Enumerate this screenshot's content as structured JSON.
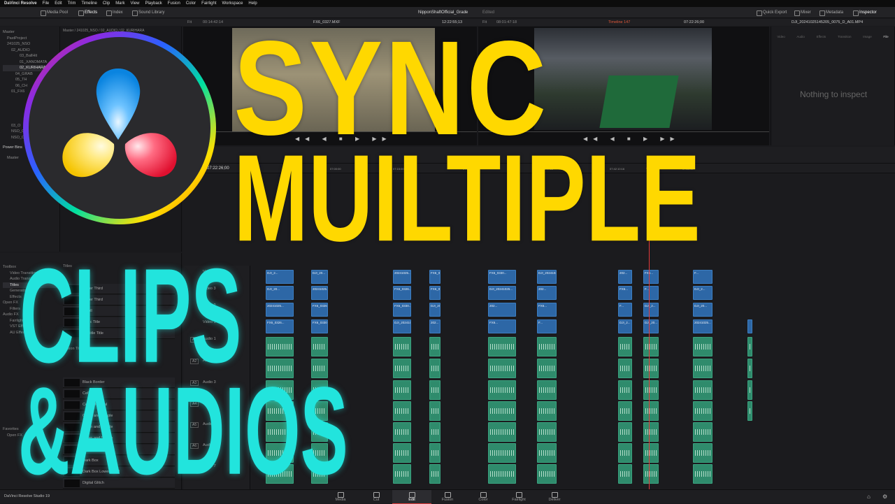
{
  "menu": {
    "items": [
      "DaVinci Resolve",
      "File",
      "Edit",
      "Trim",
      "Timeline",
      "Clip",
      "Mark",
      "View",
      "Playback",
      "Fusion",
      "Color",
      "Fairlight",
      "Workspace",
      "Help"
    ]
  },
  "toolbar": {
    "media_pool": "Media Pool",
    "effects": "Effects",
    "index": "Index",
    "sound_library": "Sound Library",
    "project_title": "NipponShaftOfficial_Grade",
    "edited": "Edited",
    "quick_export": "Quick Export",
    "mixer": "Mixer",
    "metadata": "Metadata",
    "inspector": "Inspector"
  },
  "source_viewer": {
    "fit": "Fit",
    "duration": "00:14:42:14",
    "clip_name": "FX6_0327.MXF",
    "timecode": "12:22:55;13"
  },
  "timeline_viewer": {
    "fit": "Fit",
    "duration": "08:01:47:18",
    "timeline_name": "Timeline 147",
    "timecode": "07:22:26;00"
  },
  "media_pool": {
    "path": "Master / 241025_NSO / 02_AUDIO / 02_KURIHARA",
    "tree": [
      "Master",
      "PastProject",
      "241025_NSO",
      "02_AUDIO",
      "03_BallHit",
      "01_XANOMATA",
      "02_KURIHARA",
      "04_GRAB",
      "05_TH",
      "06_CH",
      "01_FX6",
      "03_O",
      "NSO_C",
      "NSO_OFF"
    ],
    "power_bins": "Power Bins",
    "power_master": "Master"
  },
  "inspector": {
    "clip_name": "DJI_20241025145205_0075_D_A01.MP4",
    "tabs": [
      "Video",
      "Audio",
      "Effects",
      "Transition",
      "Image",
      "File"
    ],
    "empty_message": "Nothing to inspect"
  },
  "effects_panel": {
    "tree": [
      "Toolbox",
      "Video Transitions",
      "Audio Transitions",
      "Titles",
      "Generators",
      "Effects",
      "Open FX",
      "Filters",
      "Audio FX",
      "Fairlight FX",
      "VST Effects",
      "AU Effects",
      "Favorites",
      "Open FX"
    ],
    "header": "Titles",
    "fusion_header": "Fusion Titles",
    "items": [
      "Lower Third",
      "Lower Third",
      "Scroll",
      "Basic Title",
      "Subtitle Title",
      "Black Border",
      "Cell Out",
      "Center Reveal",
      "Clean and Simple",
      "Clean and Simple",
      "Clean and Simple",
      "Cond. Slide",
      "Dark Box",
      "Dark Box Lower Third",
      "Digital Glitch"
    ]
  },
  "timeline": {
    "current_timecode": "07:22:26;00",
    "ruler_marks": [
      "07:00:00",
      "07:15:00",
      "07:25:16:10",
      "07:33:44:12",
      "07:42:10:16",
      "07:50:19"
    ],
    "tracks": [
      {
        "id": "V4",
        "name": "Video 4"
      },
      {
        "id": "V3",
        "name": "Video 3"
      },
      {
        "id": "V2",
        "name": "Video 2"
      },
      {
        "id": "V1",
        "name": "Video 1"
      },
      {
        "id": "A1",
        "name": "Audio 1"
      },
      {
        "id": "A2",
        "name": "Audio 2"
      },
      {
        "id": "A3",
        "name": "Audio 3"
      },
      {
        "id": "A4",
        "name": "Audio 4"
      },
      {
        "id": "A5",
        "name": "Audio 5"
      },
      {
        "id": "A6",
        "name": "Audio 6"
      },
      {
        "id": "A7",
        "name": "Audio 7"
      }
    ],
    "clip_labels": [
      "DJI_2...",
      "DJI_20...",
      "20241025...",
      "FX6_0326...",
      "FX6_0330...",
      "DJI_20241025...",
      "202...",
      "FX6...",
      "F..."
    ]
  },
  "thumbnail_text": {
    "line1": "SYNC",
    "line2": "MUILTIPLE",
    "line3": "CLIPS",
    "line4": "&AUDIOS"
  },
  "pages": [
    "Media",
    "Cut",
    "Edit",
    "Fusion",
    "Color",
    "Fairlight",
    "Deliver"
  ],
  "active_page": "Edit",
  "app_version": "DaVinci Resolve Studio 19",
  "colors": {
    "accent_red": "#e23a3a",
    "title_yellow": "#ffd800",
    "title_cyan": "#22e4dd",
    "video_clip": "#2d67a6",
    "audio_clip": "#2f8b6c"
  }
}
